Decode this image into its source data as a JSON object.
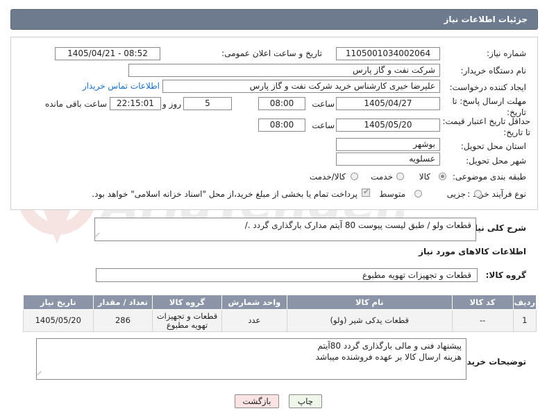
{
  "header": {
    "title": "جزئیات اطلاعات نیاز"
  },
  "watermark": {
    "text": "AriaTender.net"
  },
  "form": {
    "need_number_label": "شماره نیاز:",
    "need_number": "1105001034002064",
    "announce_label": "تاریخ و ساعت اعلان عمومی:",
    "announce_value": "1405/04/21 - 08:52",
    "buyer_org_label": "نام دستگاه خریدار:",
    "buyer_org": "شرکت نفت و گاز پارس",
    "creator_label": "ایجاد کننده درخواست:",
    "creator": "علیرضا  خیری کارشناس خرید   شرکت نفت و گاز پارس",
    "contact_link": "اطلاعات تماس خریدار",
    "reply_deadline_label": "مهلت ارسال پاسخ: تا تاریخ:",
    "reply_date": "1405/04/27",
    "time_label": "ساعت",
    "reply_time": "08:00",
    "days_value": "5",
    "days_label": "روز و",
    "remaining_time": "22:15:01",
    "remaining_label": "ساعت باقی مانده",
    "price_deadline_label": "حداقل تاریخ اعتبار قیمت: تا تاریخ:",
    "price_date": "1405/05/20",
    "price_time": "08:00",
    "province_label": "استان محل تحویل:",
    "province": "بوشهر",
    "city_label": "شهر محل تحویل:",
    "city": "عسلویه",
    "category_label": "طبقه بندی موضوعی:",
    "category_options": [
      "کالا",
      "خدمت",
      "کالا/خدمت"
    ],
    "process_label": "نوع فرآیند خرید :",
    "process_options": [
      "جزیی",
      "متوسط"
    ],
    "payment_note": "پرداخت تمام یا بخشی از مبلغ خرید،از محل \"اسناد خزانه اسلامی\" خواهد بود."
  },
  "description": {
    "label": "شرح کلی نیاز:",
    "text": "قطعات ولو  / طبق لیست پیوست  80 آیتم مدارک بارگذاری گردد ./"
  },
  "goods_info": {
    "title": "اطلاعات کالاهای مورد نیاز",
    "group_label": "گروه کالا:",
    "group_value": "قطعات و تجهیزات تهویه مطبوع"
  },
  "table": {
    "headers": [
      "ردیف",
      "کد کالا",
      "نام کالا",
      "واحد شمارش",
      "گروه کالا",
      "تعداد / مقدار",
      "تاریخ نیاز"
    ],
    "rows": [
      [
        "1",
        "--",
        "قطعات یدکی شیر (ولو)",
        "عدد",
        "قطعات و تجهیزات تهویه مطبوع",
        "286",
        "1405/05/20"
      ]
    ]
  },
  "buyer_notes": {
    "label": "توضیحات خریدار:",
    "line1": "پیشنهاد فنی و مالی بارگذاری گردد 80آیتم",
    "line2": "هزینه ارسال کالا بر عهده فروشنده میباشد"
  },
  "buttons": {
    "print": "چاپ",
    "back": "بازگشت"
  }
}
